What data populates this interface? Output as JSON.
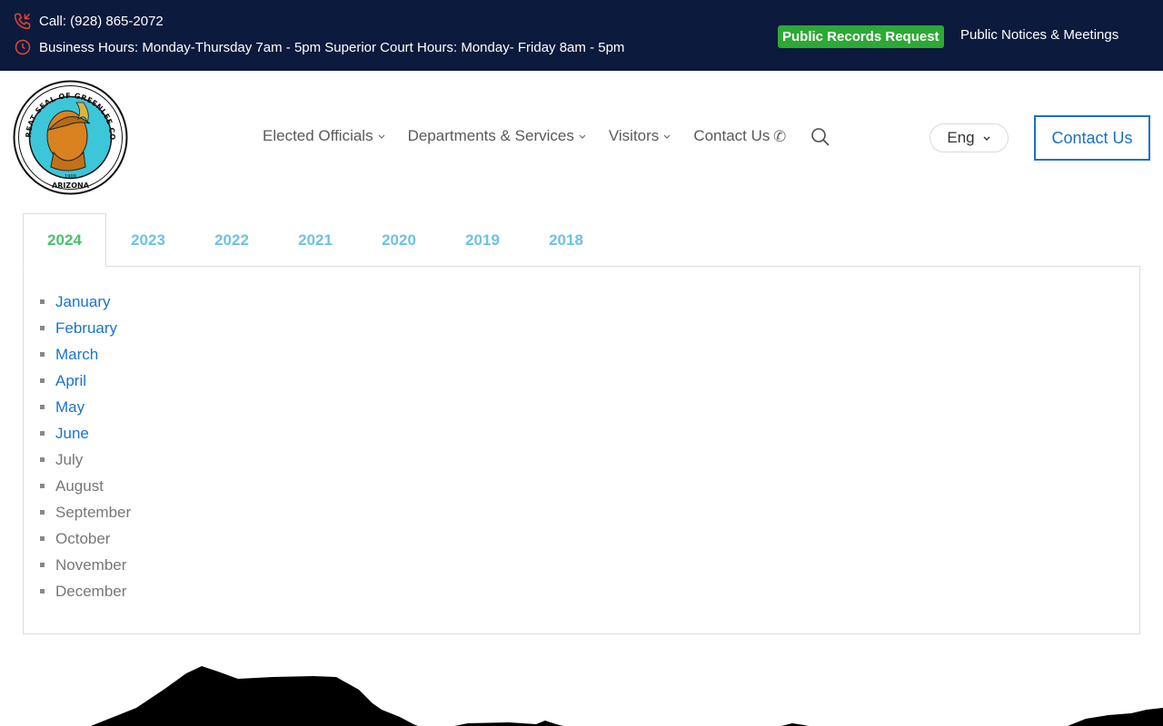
{
  "topbar": {
    "phone_text": "Call: (928) 865-2072",
    "hours_text": "Business Hours: Monday-Thursday 7am - 5pm Superior Court Hours: Monday- Friday 8am - 5pm",
    "records_label": "Public Records Request",
    "notices_label": "Public Notices & Meetings"
  },
  "nav": {
    "items": [
      {
        "label": "Elected Officials"
      },
      {
        "label": "Departments & Services"
      },
      {
        "label": "Visitors"
      },
      {
        "label": "Contact Us"
      }
    ],
    "lang_label": "Eng",
    "contact_button": "Contact Us"
  },
  "tabs": [
    "2024",
    "2023",
    "2022",
    "2021",
    "2020",
    "2019",
    "2018"
  ],
  "months": [
    {
      "label": "January",
      "link": true
    },
    {
      "label": "February",
      "link": true
    },
    {
      "label": "March",
      "link": true
    },
    {
      "label": "April",
      "link": true
    },
    {
      "label": "May",
      "link": true
    },
    {
      "label": "June",
      "link": true
    },
    {
      "label": "July",
      "link": false
    },
    {
      "label": "August",
      "link": false
    },
    {
      "label": "September",
      "link": false
    },
    {
      "label": "October",
      "link": false
    },
    {
      "label": "November",
      "link": false
    },
    {
      "label": "December",
      "link": false
    }
  ],
  "colors": {
    "topbar_bg": "#0b1a3d",
    "records_green": "#2ea836",
    "link_blue": "#1a73d1",
    "active_tab_green": "#49c26a",
    "inactive_tab_blue": "#6fc0e6",
    "icon_red": "#e8423a"
  },
  "icons": {
    "phone": "phone-icon",
    "clock": "clock-icon",
    "search": "search-icon",
    "chevron": "chevron-down-icon",
    "seal": "county-seal-logo"
  },
  "seal_text": {
    "ring": "THE GREAT SEAL OF GREENLEE COUNTY",
    "bottom": "ARIZONA",
    "year": "1909"
  }
}
